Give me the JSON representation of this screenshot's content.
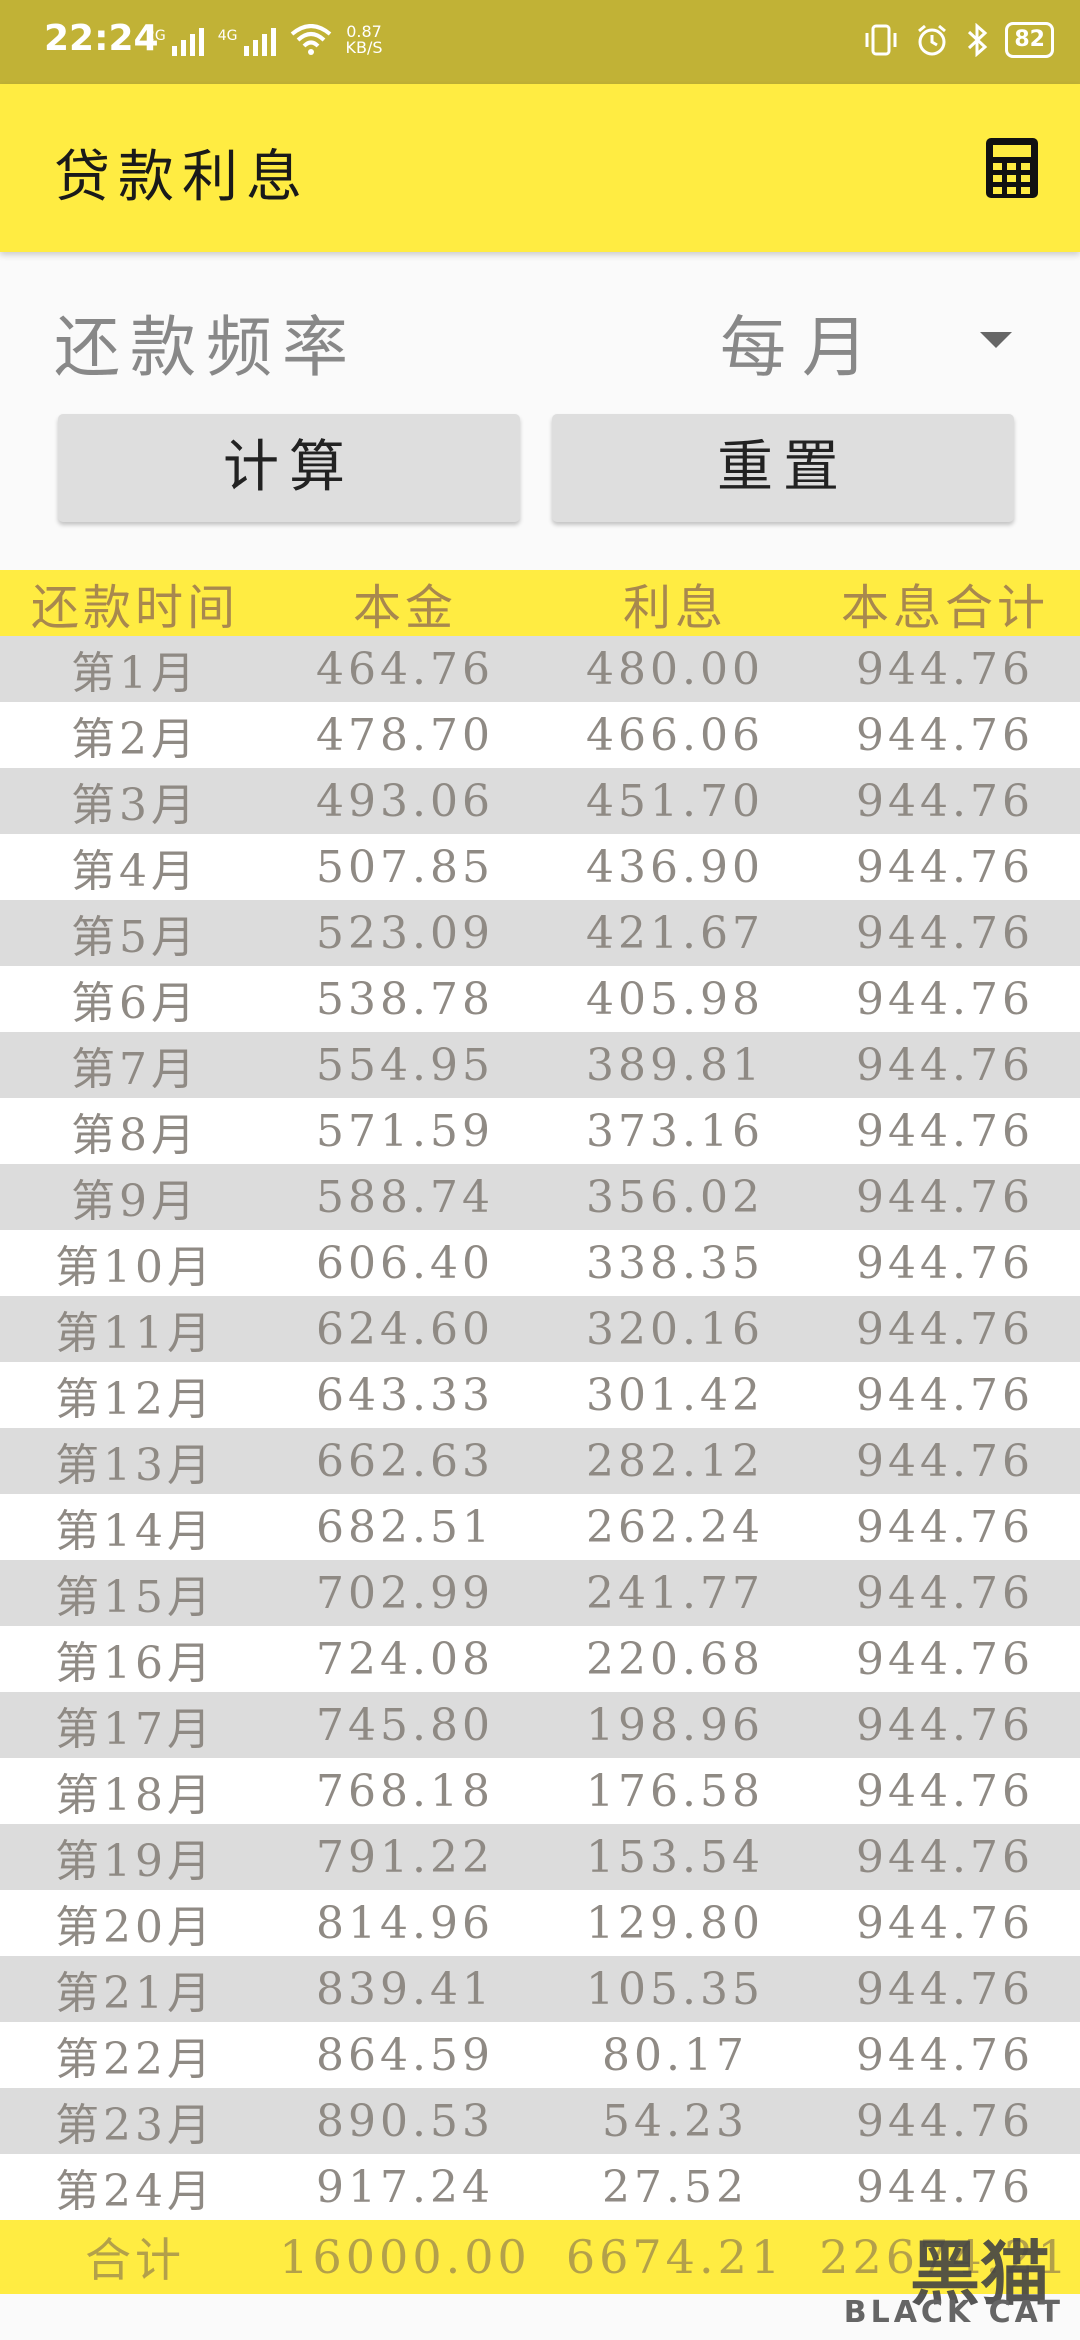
{
  "status_bar": {
    "time": "22:24",
    "sim1": "2G",
    "sim2": "4G",
    "speed_value": "0.87",
    "speed_unit": "KB/S",
    "battery": "82"
  },
  "app_bar": {
    "title": "贷款利息",
    "calculator_icon": "calculator-icon"
  },
  "form": {
    "frequency_label": "还款频率",
    "frequency_value": "每月",
    "calculate_label": "计算",
    "reset_label": "重置"
  },
  "table": {
    "headers": [
      "还款时间",
      "本金",
      "利息",
      "本息合计"
    ],
    "rows": [
      [
        "第1月",
        "464.76",
        "480.00",
        "944.76"
      ],
      [
        "第2月",
        "478.70",
        "466.06",
        "944.76"
      ],
      [
        "第3月",
        "493.06",
        "451.70",
        "944.76"
      ],
      [
        "第4月",
        "507.85",
        "436.90",
        "944.76"
      ],
      [
        "第5月",
        "523.09",
        "421.67",
        "944.76"
      ],
      [
        "第6月",
        "538.78",
        "405.98",
        "944.76"
      ],
      [
        "第7月",
        "554.95",
        "389.81",
        "944.76"
      ],
      [
        "第8月",
        "571.59",
        "373.16",
        "944.76"
      ],
      [
        "第9月",
        "588.74",
        "356.02",
        "944.76"
      ],
      [
        "第10月",
        "606.40",
        "338.35",
        "944.76"
      ],
      [
        "第11月",
        "624.60",
        "320.16",
        "944.76"
      ],
      [
        "第12月",
        "643.33",
        "301.42",
        "944.76"
      ],
      [
        "第13月",
        "662.63",
        "282.12",
        "944.76"
      ],
      [
        "第14月",
        "682.51",
        "262.24",
        "944.76"
      ],
      [
        "第15月",
        "702.99",
        "241.77",
        "944.76"
      ],
      [
        "第16月",
        "724.08",
        "220.68",
        "944.76"
      ],
      [
        "第17月",
        "745.80",
        "198.96",
        "944.76"
      ],
      [
        "第18月",
        "768.18",
        "176.58",
        "944.76"
      ],
      [
        "第19月",
        "791.22",
        "153.54",
        "944.76"
      ],
      [
        "第20月",
        "814.96",
        "129.80",
        "944.76"
      ],
      [
        "第21月",
        "839.41",
        "105.35",
        "944.76"
      ],
      [
        "第22月",
        "864.59",
        "80.17",
        "944.76"
      ],
      [
        "第23月",
        "890.53",
        "54.23",
        "944.76"
      ],
      [
        "第24月",
        "917.24",
        "27.52",
        "944.76"
      ]
    ],
    "total": [
      "合计",
      "16000.00",
      "6674.21",
      "22674.21"
    ]
  },
  "watermark": {
    "brand_cn": "黑猫",
    "brand_en": "BLACK CAT"
  }
}
